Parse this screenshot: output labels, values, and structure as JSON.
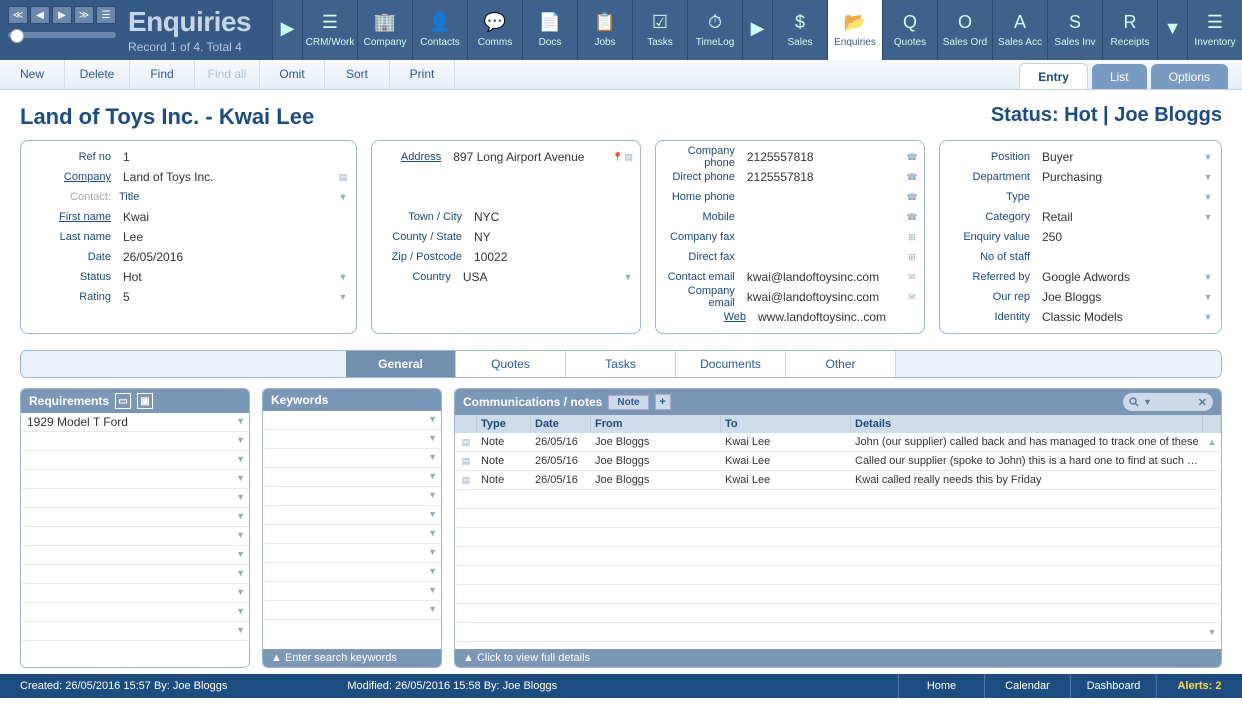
{
  "header": {
    "title": "Enquiries",
    "record_info": "Record 1 of 4. Total 4"
  },
  "modules": [
    {
      "label": "CRM/Work"
    },
    {
      "label": "Company"
    },
    {
      "label": "Contacts"
    },
    {
      "label": "Comms"
    },
    {
      "label": "Docs"
    },
    {
      "label": "Jobs"
    },
    {
      "label": "Tasks"
    },
    {
      "label": "TimeLog"
    },
    {
      "label": "Sales"
    },
    {
      "label": "Enquiries"
    },
    {
      "label": "Quotes"
    },
    {
      "label": "Sales Ord"
    },
    {
      "label": "Sales Acc"
    },
    {
      "label": "Sales Inv"
    },
    {
      "label": "Receipts"
    },
    {
      "label": "Inventory"
    }
  ],
  "toolbar": {
    "new": "New",
    "delete": "Delete",
    "find": "Find",
    "find_all": "Find all",
    "omit": "Omit",
    "sort": "Sort",
    "print": "Print"
  },
  "view_tabs": {
    "entry": "Entry",
    "list": "List",
    "options": "Options"
  },
  "page": {
    "title": "Land of Toys Inc. - Kwai Lee",
    "status": "Status: Hot | Joe Bloggs"
  },
  "left_fields": {
    "labels": {
      "ref_no": "Ref no",
      "company": "Company",
      "contact": "Contact:",
      "title": "Title",
      "first_name": "First name",
      "last_name": "Last name",
      "date": "Date",
      "status": "Status",
      "rating": "Rating"
    },
    "ref_no": "1",
    "company": "Land of Toys Inc.",
    "title": "",
    "first_name": "Kwai",
    "last_name": "Lee",
    "date": "26/05/2016",
    "status": "Hot",
    "rating": "5"
  },
  "address_fields": {
    "labels": {
      "address": "Address",
      "town": "Town / City",
      "county": "County / State",
      "zip": "Zip / Postcode",
      "country": "Country"
    },
    "address": "897 Long Airport Avenue",
    "town": "NYC",
    "county": "NY",
    "zip": "10022",
    "country": "USA"
  },
  "contact_fields": {
    "labels": {
      "company_phone": "Company phone",
      "direct_phone": "Direct phone",
      "home_phone": "Home phone",
      "mobile": "Mobile",
      "company_fax": "Company fax",
      "direct_fax": "Direct fax",
      "contact_email": "Contact email",
      "company_email": "Company email",
      "web": "Web"
    },
    "company_phone": "2125557818",
    "direct_phone": "2125557818",
    "home_phone": "",
    "mobile": "",
    "company_fax": "",
    "direct_fax": "",
    "contact_email": "kwai@landoftoysinc.com",
    "company_email": "kwai@landoftoysinc.com",
    "web": "www.landoftoysinc..com"
  },
  "right_fields": {
    "labels": {
      "position": "Position",
      "department": "Department",
      "type": "Type",
      "category": "Category",
      "enquiry_value": "Enquiry value",
      "no_of_staff": "No of staff",
      "referred_by": "Referred by",
      "our_rep": "Our rep",
      "identity": "Identity"
    },
    "position": "Buyer",
    "department": "Purchasing",
    "type": "",
    "category": "Retail",
    "enquiry_value": "250",
    "no_of_staff": "",
    "referred_by": "Google Adwords",
    "our_rep": "Joe Bloggs",
    "identity": "Classic Models"
  },
  "section_tabs": {
    "general": "General",
    "quotes": "Quotes",
    "tasks": "Tasks",
    "documents": "Documents",
    "other": "Other"
  },
  "requirements": {
    "title": "Requirements",
    "items": [
      "1929 Model T Ford"
    ]
  },
  "keywords": {
    "title": "Keywords",
    "footer": "▲  Enter search keywords"
  },
  "comms": {
    "title": "Communications / notes",
    "note_btn": "Note",
    "columns": {
      "type": "Type",
      "date": "Date",
      "from": "From",
      "to": "To",
      "details": "Details"
    },
    "rows": [
      {
        "type": "Note",
        "date": "26/05/16",
        "from": "Joe Bloggs",
        "to": "Kwai Lee",
        "details": "John (our supplier) called back and has managed to track one of these"
      },
      {
        "type": "Note",
        "date": "26/05/16",
        "from": "Joe Bloggs",
        "to": "Kwai Lee",
        "details": "Called our supplier (spoke to John) this is a hard one to find at such short"
      },
      {
        "type": "Note",
        "date": "26/05/16",
        "from": "Joe Bloggs",
        "to": "Kwai Lee",
        "details": "Kwai called really needs this by Friday"
      }
    ],
    "footer": "▲  Click to view full details"
  },
  "footer": {
    "created": "Created: 26/05/2016  15:57   By:  Joe Bloggs",
    "modified": "Modified: 26/05/2016  15:58   By:  Joe Bloggs",
    "home": "Home",
    "calendar": "Calendar",
    "dashboard": "Dashboard",
    "alerts": "Alerts: 2"
  }
}
